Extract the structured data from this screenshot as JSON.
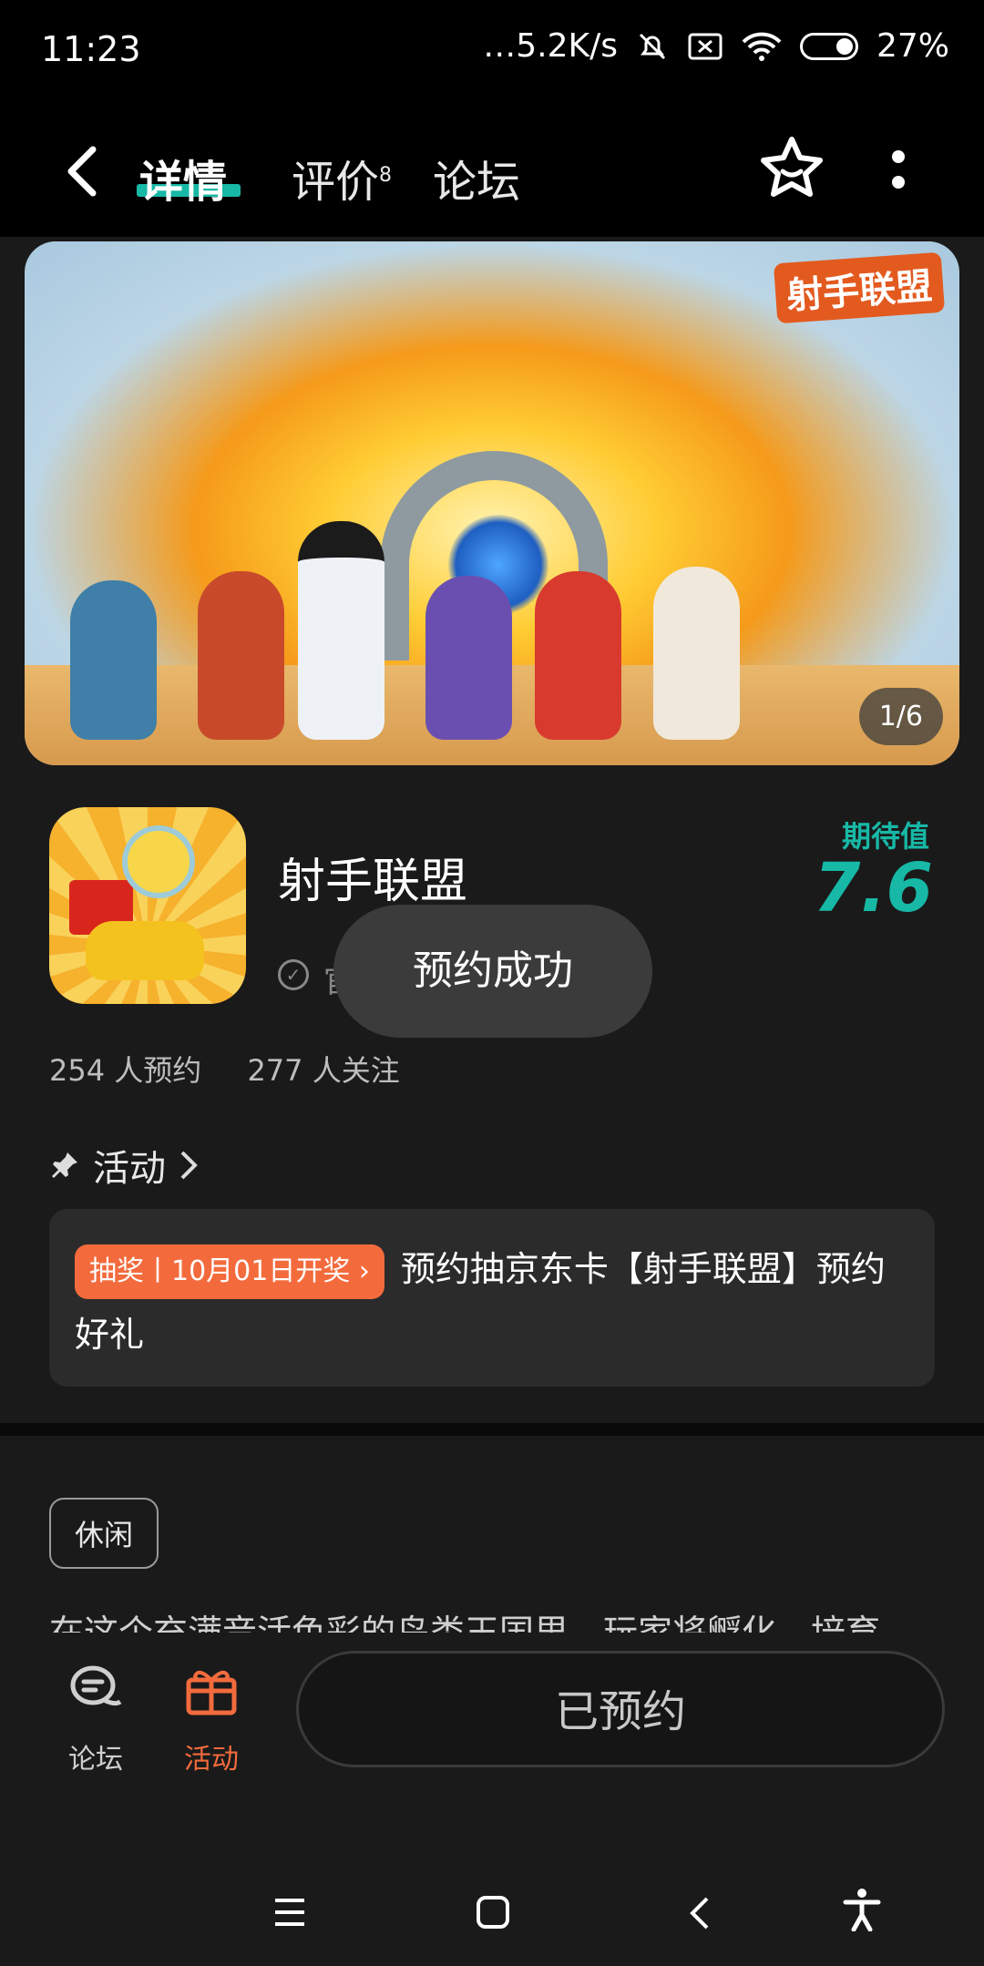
{
  "status_bar": {
    "time": "11:23",
    "net_speed": "…5.2K/s",
    "battery": "27%"
  },
  "header": {
    "tabs": [
      {
        "label": "详情",
        "active": true
      },
      {
        "label": "评价",
        "badge": "8"
      },
      {
        "label": "论坛"
      }
    ]
  },
  "banner": {
    "logo_text": "射手联盟",
    "counter": "1/6"
  },
  "app": {
    "name": "射手联盟",
    "verified_partial": "官",
    "score_label": "期待值",
    "score": "7.6",
    "reservations": "254 人预约",
    "followers": "277 人关注"
  },
  "activity": {
    "heading": "活动",
    "badge": "抽奖丨10月01日开奖 ›",
    "text": "预约抽京东卡【射手联盟】预约好礼"
  },
  "tags": [
    "休闲"
  ],
  "description": "在这个充满音活色彩的鸟类王国里，玩家将孵化、培育",
  "toast": "预约成功",
  "bottom_bar": {
    "forum_label": "论坛",
    "activity_label": "活动",
    "reserved_label": "已预约",
    "accent": "#f36b3d"
  },
  "colors": {
    "score": "#17b8a6"
  }
}
